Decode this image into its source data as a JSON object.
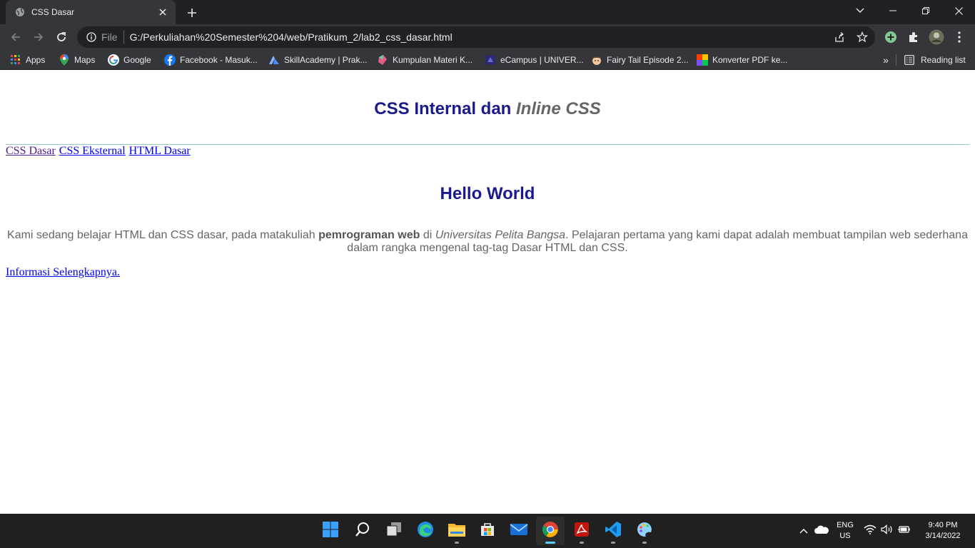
{
  "window": {
    "tab_title": "CSS Dasar",
    "new_tab_label": "+"
  },
  "toolbar": {
    "scheme_label": "File",
    "url": "G:/Perkuliahan%20Semester%204/web/Pratikum_2/lab2_css_dasar.html"
  },
  "bookmarks": {
    "items": [
      {
        "label": "Apps",
        "icon": "apps-grid-icon"
      },
      {
        "label": "Maps",
        "icon": "maps-pin-icon"
      },
      {
        "label": "Google",
        "icon": "google-icon"
      },
      {
        "label": "Facebook - Masuk...",
        "icon": "facebook-icon"
      },
      {
        "label": "SkillAcademy | Prak...",
        "icon": "skillacademy-icon"
      },
      {
        "label": "Kumpulan Materi K...",
        "icon": "kumpulan-icon"
      },
      {
        "label": "eCampus | UNIVER...",
        "icon": "ecampus-icon"
      },
      {
        "label": "Fairy Tail Episode 2...",
        "icon": "fairytail-icon"
      },
      {
        "label": "Konverter PDF ke...",
        "icon": "konverter-icon"
      }
    ],
    "more_label": "»",
    "reading_list_label": "Reading list"
  },
  "page": {
    "heading_part1": "CSS Internal dan",
    "heading_part2": "Inline CSS",
    "nav_links": [
      "CSS Dasar",
      "CSS Eksternal",
      "HTML Dasar"
    ],
    "hello_heading": "Hello World",
    "paragraph": {
      "text1": "Kami sedang belajar HTML dan CSS dasar, pada matakuliah",
      "bold": "pemrograman web",
      "text2": "di",
      "italic": "Universitas Pelita Bangsa",
      "text3": ". Pelajaran pertama yang kami dapat adalah membuat tampilan web sederhana dalam rangka mengenal tag-tag Dasar HTML dan CSS."
    },
    "more_link": "Informasi Selengkapnya."
  },
  "taskbar": {
    "apps": [
      "start-icon",
      "search-icon",
      "task-view-icon",
      "edge-icon",
      "file-explorer-icon",
      "microsoft-store-icon",
      "mail-icon",
      "chrome-icon",
      "acrobat-icon",
      "vscode-icon",
      "paint-icon"
    ],
    "language_line1": "ENG",
    "language_line2": "US",
    "time": "9:40 PM",
    "date": "3/14/2022"
  },
  "colors": {
    "heading": "#1a1a8c",
    "body_text": "#666666",
    "link": "#0000ee",
    "visited_link": "#551a8b",
    "rule": "#8fc9cf"
  }
}
